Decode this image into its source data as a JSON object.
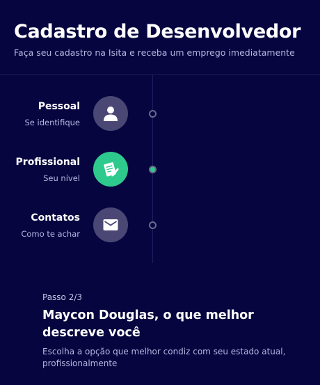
{
  "header": {
    "title": "Cadastro de Desenvolvedor",
    "subtitle": "Faça seu cadastro na Isita e receba um emprego imediatamente"
  },
  "steps": [
    {
      "title": "Pessoal",
      "subtitle": "Se identifique",
      "icon": "user-icon",
      "active": false
    },
    {
      "title": "Profissional",
      "subtitle": "Seu nível",
      "icon": "document-edit-icon",
      "active": true
    },
    {
      "title": "Contatos",
      "subtitle": "Como te achar",
      "icon": "envelope-icon",
      "active": false
    }
  ],
  "form": {
    "step_label": "Passo 2/3",
    "question": "Maycon Douglas, o que melhor descreve você",
    "description": "Escolha a opção que melhor condiz com seu estado atual, profissionalmente"
  },
  "colors": {
    "background": "#06053f",
    "active_step": "#2ec98c",
    "inactive_step": "#4a4775"
  }
}
